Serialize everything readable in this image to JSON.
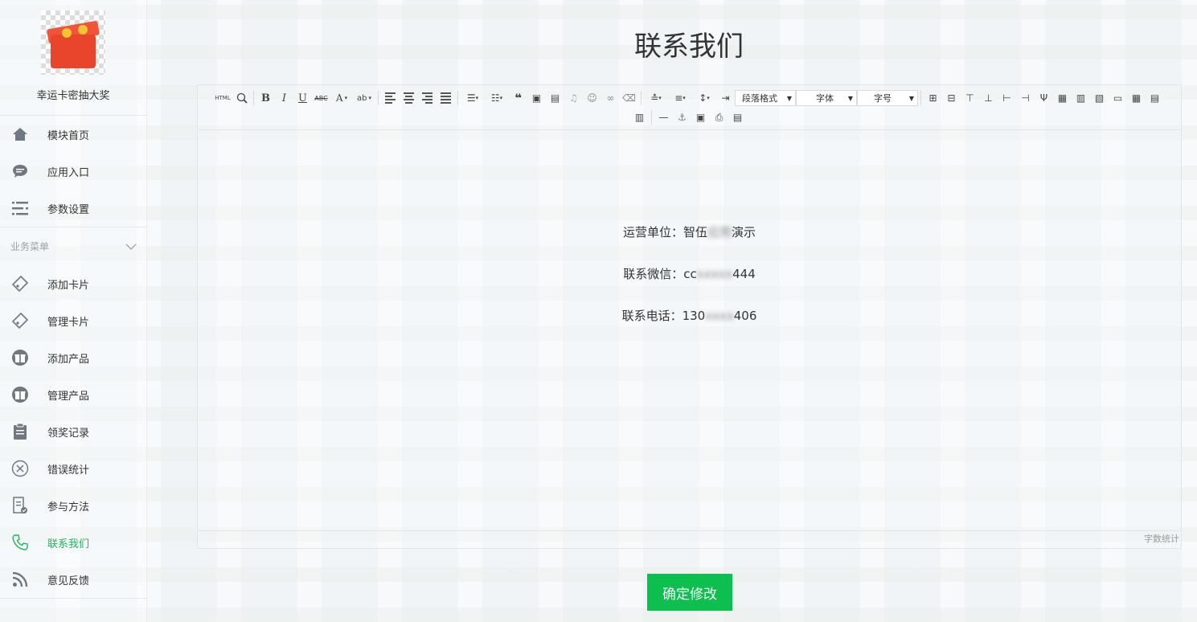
{
  "brand": {
    "name": "幸运卡密抽大奖"
  },
  "nav_top": [
    {
      "label": "模块首页",
      "icon": "home-icon"
    },
    {
      "label": "应用入口",
      "icon": "chat-bubble-icon"
    },
    {
      "label": "参数设置",
      "icon": "list-settings-icon"
    }
  ],
  "section": {
    "label": "业务菜单"
  },
  "nav_business": [
    {
      "label": "添加卡片",
      "icon": "tag-icon"
    },
    {
      "label": "管理卡片",
      "icon": "tag-icon"
    },
    {
      "label": "添加产品",
      "icon": "gift-icon"
    },
    {
      "label": "管理产品",
      "icon": "gift-icon"
    },
    {
      "label": "领奖记录",
      "icon": "clipboard-icon"
    },
    {
      "label": "错误统计",
      "icon": "close-circle-icon"
    },
    {
      "label": "参与方法",
      "icon": "document-check-icon"
    },
    {
      "label": "联系我们",
      "icon": "phone-icon",
      "active": true
    },
    {
      "label": "意见反馈",
      "icon": "rss-icon"
    }
  ],
  "page": {
    "title": "联系我们"
  },
  "toolbar": {
    "html_label": "HTML",
    "paragraph_format": "段落格式",
    "font_family": "字体",
    "font_size": "字号"
  },
  "content": {
    "line1_prefix": "运营单位：智伍",
    "line1_blurred": "应用",
    "line1_suffix": "演示",
    "line2_prefix": "联系微信：cc",
    "line2_blurred": "xxxxx",
    "line2_suffix": "444",
    "line3_prefix": "联系电话：130",
    "line3_blurred": "xxxx",
    "line3_suffix": "406"
  },
  "editor_footer": {
    "word_count": "字数统计"
  },
  "actions": {
    "submit_label": "确定修改"
  },
  "colors": {
    "accent": "#1fb55a",
    "button": "#0cbf4e"
  }
}
